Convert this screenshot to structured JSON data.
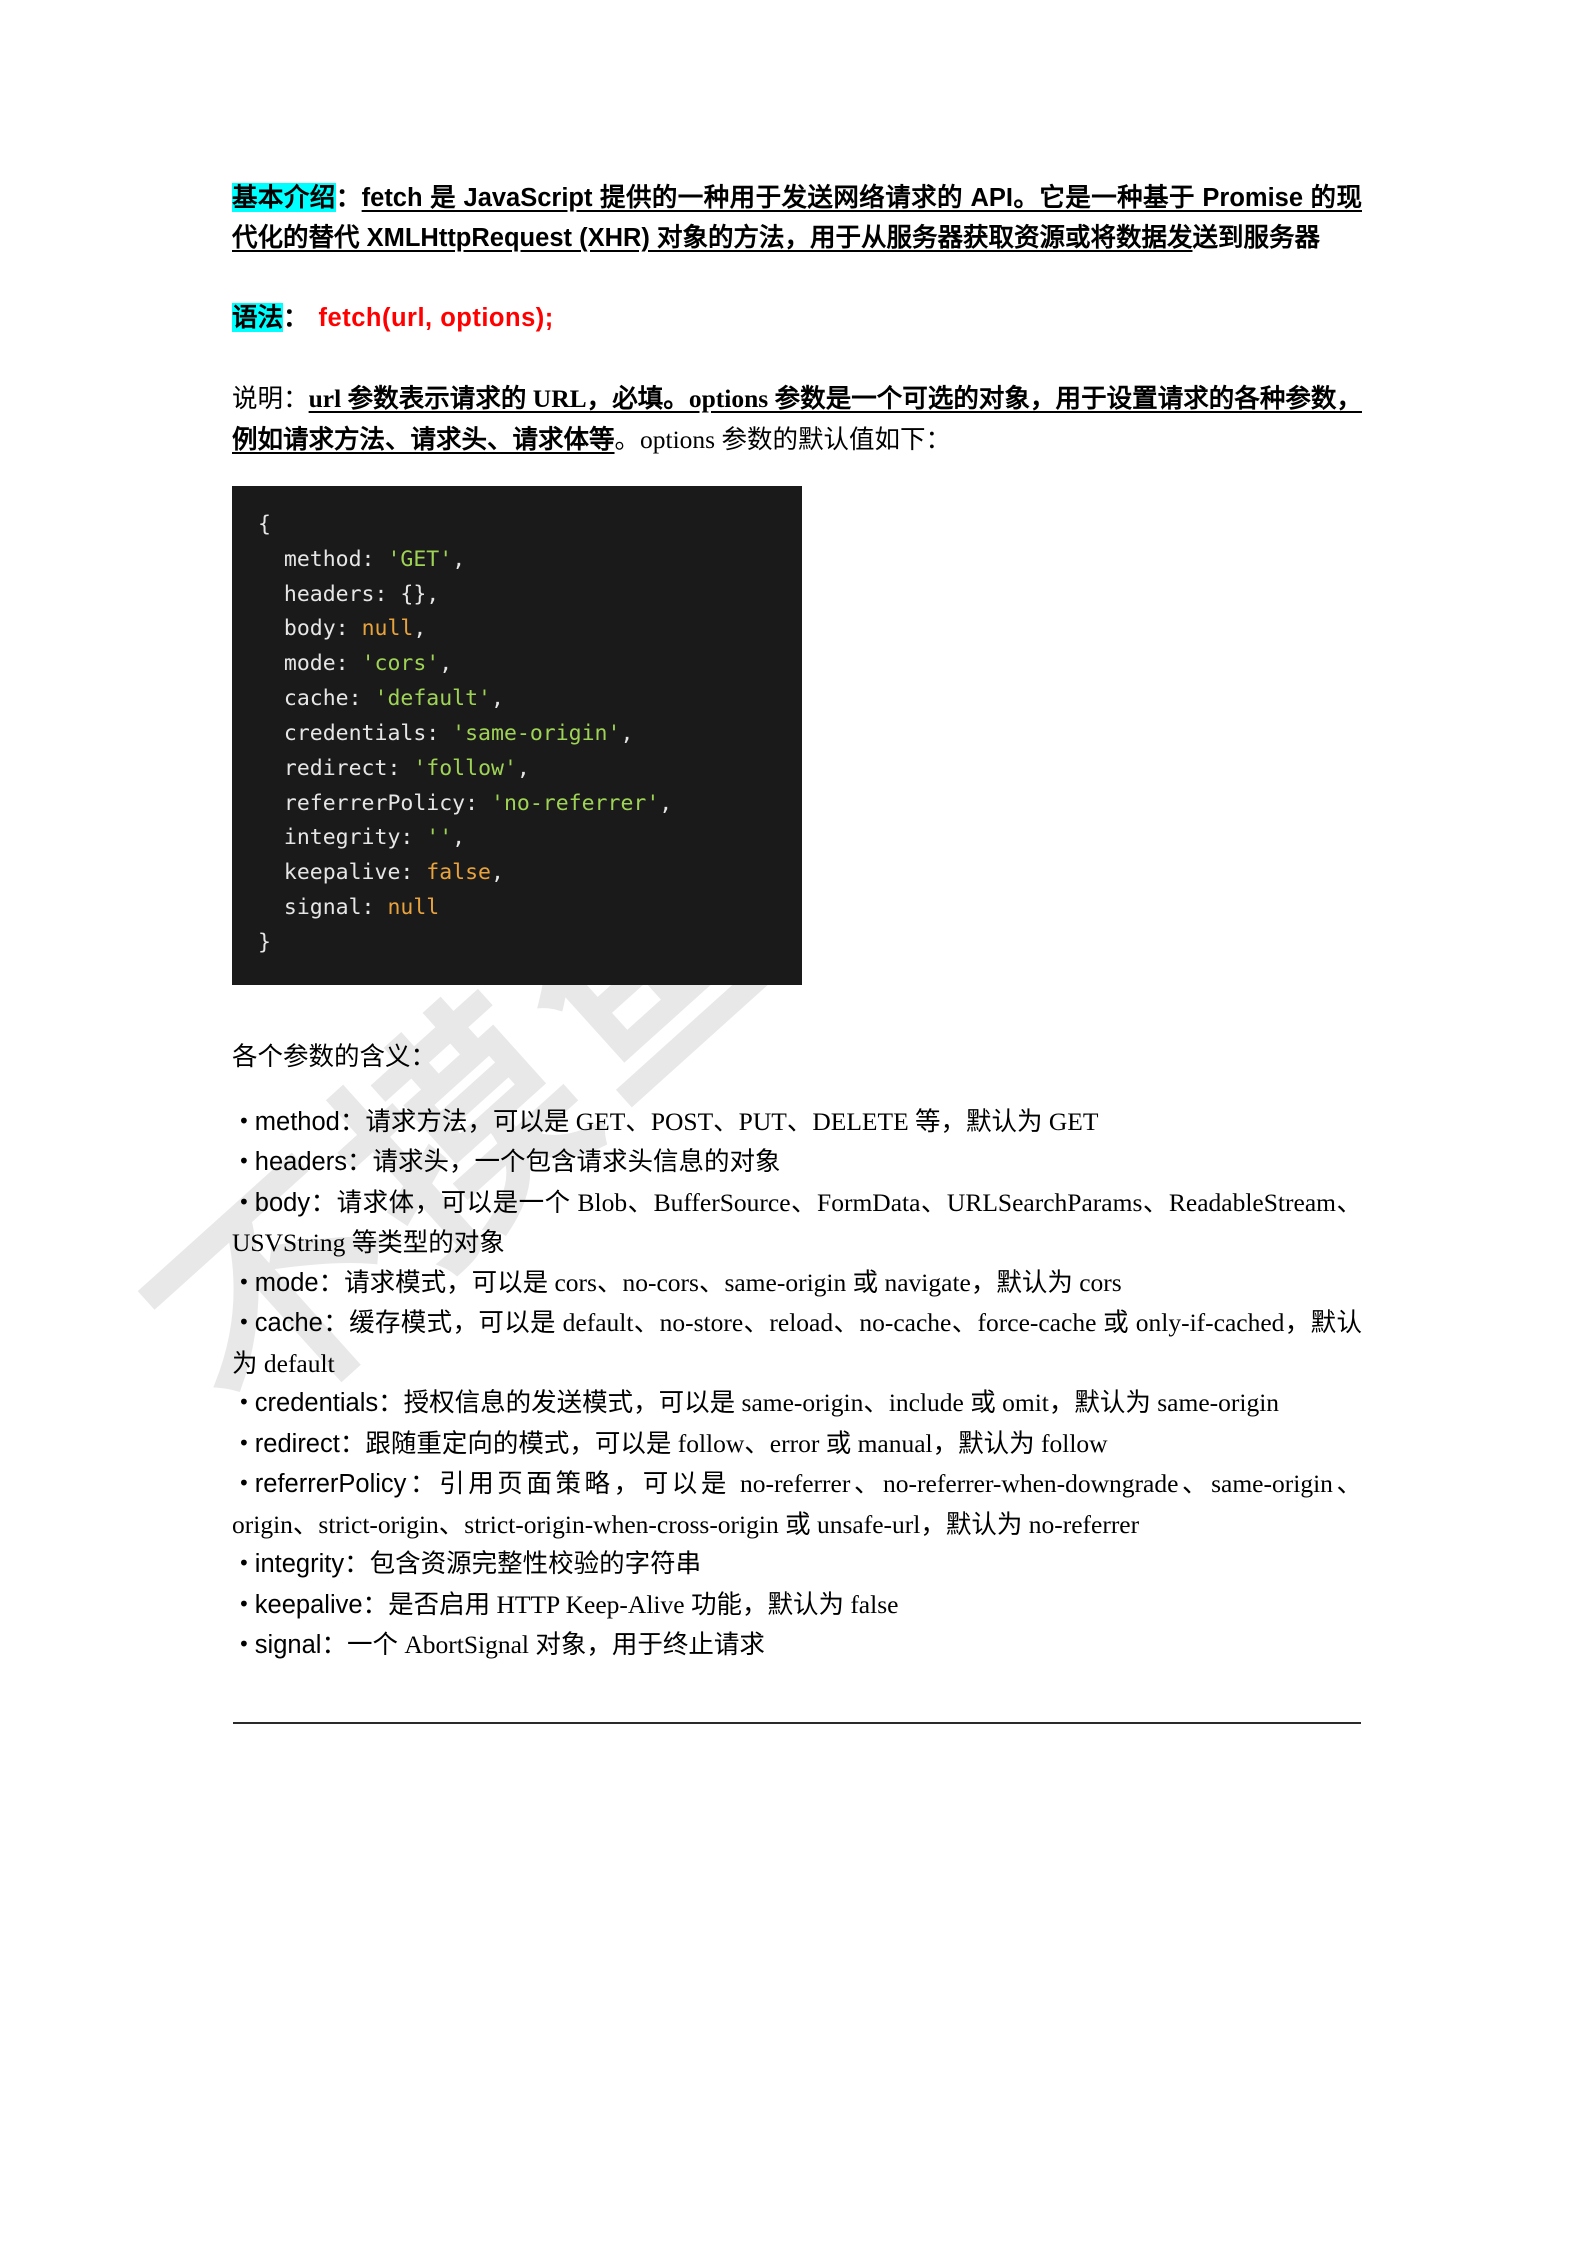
{
  "watermark": {
    "text": "不摸鱼",
    "color": "#e8e8e8"
  },
  "colors": {
    "highlight": "#00ffff",
    "syntax_red": "#ff0000",
    "code_bg": "#1a1a1a",
    "code_key": "#e6e6e6",
    "code_string": "#9fd356",
    "code_literal": "#e8a33d"
  },
  "intro": {
    "label": "基本介绍",
    "colon": "：",
    "body_bold": "fetch 是 JavaScript 提供的一种用于发送网络请求的 API。它是一种基于 Promise 的现代化的替代 XMLHttpRequest (XHR) 对象的方法，用于从服务器获取资源或将数据发",
    "body_tail": "送到服务器"
  },
  "syntax": {
    "label": "语法",
    "colon": "：",
    "code": "fetch(url, options);"
  },
  "description": {
    "label": "说明",
    "colon": "：",
    "bold_part": "url 参数表示请求的 URL，必填。options 参数是一个可选的对象，用于设置请求的各种参数，例如请求方法、请求头、请求体等",
    "plain_part": "。options 参数的默认值如下："
  },
  "code_block": {
    "lines": [
      {
        "indent": 0,
        "key": "",
        "punct_open": "{",
        "value": "",
        "comma": ""
      },
      {
        "indent": 1,
        "key": "method",
        "value": "'GET'",
        "value_type": "string",
        "comma": ","
      },
      {
        "indent": 1,
        "key": "headers",
        "value": "{}",
        "value_type": "punct",
        "comma": ","
      },
      {
        "indent": 1,
        "key": "body",
        "value": "null",
        "value_type": "literal",
        "comma": ","
      },
      {
        "indent": 1,
        "key": "mode",
        "value": "'cors'",
        "value_type": "string",
        "comma": ","
      },
      {
        "indent": 1,
        "key": "cache",
        "value": "'default'",
        "value_type": "string",
        "comma": ","
      },
      {
        "indent": 1,
        "key": "credentials",
        "value": "'same-origin'",
        "value_type": "string",
        "comma": ","
      },
      {
        "indent": 1,
        "key": "redirect",
        "value": "'follow'",
        "value_type": "string",
        "comma": ","
      },
      {
        "indent": 1,
        "key": "referrerPolicy",
        "value": "'no-referrer'",
        "value_type": "string",
        "comma": ","
      },
      {
        "indent": 1,
        "key": "integrity",
        "value": "''",
        "value_type": "string",
        "comma": ","
      },
      {
        "indent": 1,
        "key": "keepalive",
        "value": "false",
        "value_type": "literal",
        "comma": ","
      },
      {
        "indent": 1,
        "key": "signal",
        "value": "null",
        "value_type": "literal",
        "comma": ""
      },
      {
        "indent": 0,
        "key": "",
        "punct_open": "}",
        "value": "",
        "comma": ""
      }
    ]
  },
  "params": {
    "title": "各个参数的含义：",
    "bullet": "•",
    "items": [
      {
        "name": "method",
        "sep": "：",
        "desc": "请求方法，可以是 GET、POST、PUT、DELETE 等，默认为 GET"
      },
      {
        "name": "headers",
        "sep": "：",
        "desc": "请求头，一个包含请求头信息的对象"
      },
      {
        "name": "body",
        "sep": "：",
        "desc": "请求体，可以是一个 Blob、BufferSource、FormData、URLSearchParams、ReadableStream、USVString 等类型的对象"
      },
      {
        "name": "mode",
        "sep": "：",
        "desc": "请求模式，可以是 cors、no-cors、same-origin 或 navigate，默认为 cors"
      },
      {
        "name": "cache",
        "sep": "：",
        "desc": "缓存模式，可以是 default、no-store、reload、no-cache、force-cache 或 only-if-cached，默认为 default"
      },
      {
        "name": "credentials",
        "sep": "：",
        "desc": "授权信息的发送模式，可以是 same-origin、include 或 omit，默认为 same-origin"
      },
      {
        "name": "redirect",
        "sep": "：",
        "desc": "跟随重定向的模式，可以是 follow、error 或 manual，默认为 follow"
      },
      {
        "name": "referrerPolicy",
        "sep": "：",
        "desc": "引用页面策略，可以是 no-referrer、no-referrer-when-downgrade、same-origin、origin、strict-origin、strict-origin-when-cross-origin 或 unsafe-url，默认为 no-referrer"
      },
      {
        "name": "integrity",
        "sep": "：",
        "desc": "包含资源完整性校验的字符串"
      },
      {
        "name": "keepalive",
        "sep": "：",
        "desc": "是否启用 HTTP Keep-Alive 功能，默认为 false"
      },
      {
        "name": "signal",
        "sep": "：",
        "desc": "一个 AbortSignal 对象，用于终止请求"
      }
    ]
  }
}
